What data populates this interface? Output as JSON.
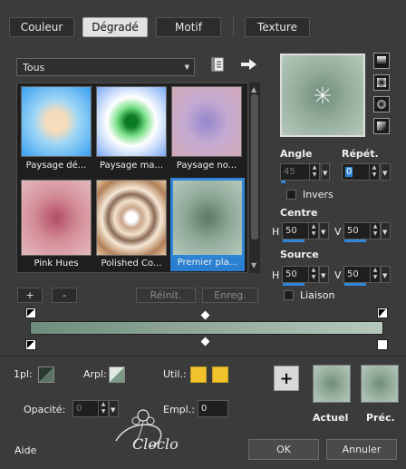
{
  "tabs": [
    "Couleur",
    "Dégradé",
    "Motif",
    "Texture"
  ],
  "active_tab": "Dégradé",
  "dropdown_value": "Tous",
  "thumbnails": [
    {
      "label": "Paysage dé...",
      "colors": [
        "#f4dcbc",
        "#9fd7f6",
        "#3a9ff0"
      ]
    },
    {
      "label": "Paysage ma...",
      "colors": [
        "#0b7a25",
        "#7be08a",
        "#ffffff",
        "#7aa8f4"
      ]
    },
    {
      "label": "Paysage no...",
      "colors": [
        "#9487cc",
        "#c4aad2",
        "#d2a9b6"
      ]
    },
    {
      "label": "Pink Hues",
      "colors": [
        "#b24c64",
        "#d48e98",
        "#e4b9bf"
      ]
    },
    {
      "label": "Polished Co...",
      "colors": [
        "#ffffff",
        "#c9a58a",
        "#f3e1ca",
        "#b18058"
      ]
    },
    {
      "label": "Premier pla...",
      "colors": [
        "#5d7766",
        "#8fa999",
        "#b5c9bb"
      ]
    }
  ],
  "selected_thumbnail": 5,
  "buttons": {
    "add": "+",
    "remove": "-",
    "reset": "Réinit.",
    "save": "Enreg.",
    "ok": "OK",
    "cancel": "Annuler",
    "plus": "+"
  },
  "angle": {
    "label": "Angle",
    "value": "45"
  },
  "repeat": {
    "label": "Répét.",
    "value": "0"
  },
  "invert": {
    "label": "Invers"
  },
  "centre": {
    "label": "Centre",
    "h_label": "H",
    "h_value": "50",
    "v_label": "V",
    "v_value": "50"
  },
  "source": {
    "label": "Source",
    "h_label": "H",
    "h_value": "50",
    "v_label": "V",
    "v_value": "50"
  },
  "link": {
    "label": "Liaison"
  },
  "bottom_labels": {
    "first": "1pl:",
    "arpl": "Arpl:",
    "util": "Util.:",
    "opacity": "Opacité:",
    "opacity_value": "0",
    "empl": "Empl.:",
    "empl_value": "0",
    "actual": "Actuel",
    "prev": "Préc."
  },
  "footer": {
    "help": "Aide",
    "watermark": "Cloclo"
  },
  "colors": {
    "gradient_dark": "#6f8c7a",
    "gradient_light": "#b6c9bb",
    "accent": "#2f86d6",
    "yellow": "#f2c22c"
  }
}
